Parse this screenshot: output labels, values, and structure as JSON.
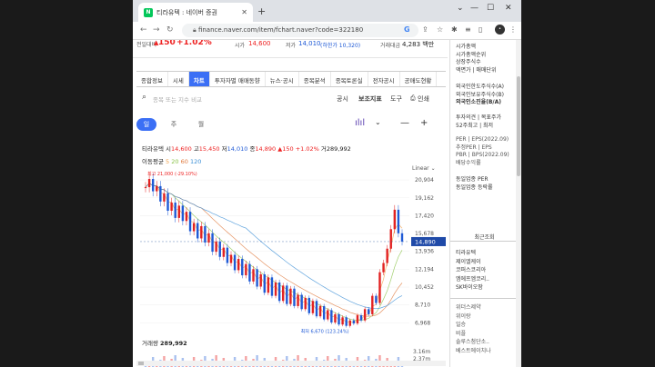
{
  "browser": {
    "tab_title": "티라유텍 : 네이버 증권",
    "favicon_text": "N",
    "url": "finance.naver.com/item/fchart.naver?code=322180",
    "profile_initial": "•"
  },
  "ticker": {
    "prev_label": "전일대비",
    "change": "150",
    "change_pct": "+1.02%",
    "open_label": "시가",
    "open": "14,600",
    "low_label": "저가",
    "low": "14,010",
    "low_limit": "(하한가 10,320)",
    "amount_label": "거래대금",
    "amount": "4,283 백만"
  },
  "nav_tabs": [
    "종합정보",
    "시세",
    "차트",
    "투자자별 매매동향",
    "뉴스·공시",
    "종목분석",
    "종목토론실",
    "전자공시",
    "공매도현황"
  ],
  "active_tab": 2,
  "toolbar": {
    "search_placeholder": "종목 또는 지수 비교",
    "disclosure": "공시",
    "indicator": "보조지표",
    "tools": "도구",
    "print": "인쇄"
  },
  "periods": [
    "일",
    "주",
    "월"
  ],
  "active_period": 0,
  "price_info": {
    "name": "티라유텍",
    "open_label": "시",
    "open": "14,600",
    "high_label": "고",
    "high": "15,450",
    "low_label": "저",
    "low": "14,010",
    "close_label": "종",
    "close": "14,890",
    "change": "▲150",
    "pct": "+1.02%",
    "vol_label": "거",
    "vol": "289,992"
  },
  "ma": {
    "label": "이동평균",
    "v5": "5",
    "v20": "20",
    "v60": "60",
    "v120": "120"
  },
  "scale_label": "Linear",
  "volume": {
    "label": "거래량",
    "value": "289,992",
    "ticks": [
      "3.16m",
      "2.37m"
    ]
  },
  "colors": {
    "up": "#e22222",
    "down": "#1f5ad6",
    "ma5": "#f0a24a",
    "ma20": "#8bc34a",
    "ma60": "#e07a3f",
    "ma120": "#3b8fd6",
    "accent": "#3b6ff5"
  },
  "chart_data": {
    "type": "line",
    "y_ticks": [
      20904,
      19162,
      17420,
      15678,
      13936,
      12194,
      10452,
      8710,
      6968
    ],
    "ylim": [
      6200,
      21800
    ],
    "current_price": 14890,
    "high_label": "최고 21,000 (-29.10%)",
    "low_label": "최저 6,670 (123.24%)",
    "series": [
      {
        "values": [
          20200,
          21000,
          19800,
          20300,
          18800,
          19600,
          17900,
          18700,
          17200,
          18400,
          16900,
          17800,
          15900,
          16700,
          15200,
          16400,
          14800,
          15700,
          13900,
          14900,
          13400,
          14300,
          12800,
          13600,
          12100,
          13200,
          11600,
          12700,
          11000,
          12200,
          10500,
          11700,
          9900,
          11400,
          9600,
          10900,
          9100,
          10600,
          8800,
          10300,
          8600,
          9700,
          8300,
          9400,
          7900,
          9100,
          7600,
          8600,
          7300,
          8200,
          7000,
          7800,
          6800,
          7500,
          6670,
          7200,
          6900,
          7700,
          7200,
          8300,
          7800,
          9600,
          8900,
          11900,
          12800,
          14200,
          16100,
          18000,
          15700,
          14890
        ]
      }
    ]
  }
}
